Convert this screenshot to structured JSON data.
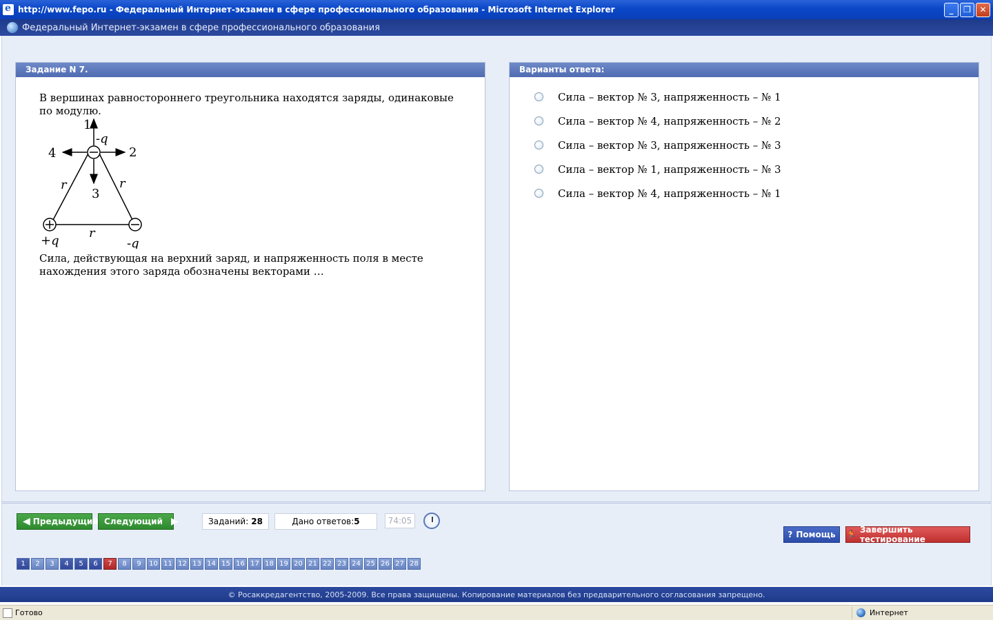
{
  "window": {
    "title": "http://www.fepo.ru - Федеральный Интернет-экзамен в сфере профессионального образования - Microsoft Internet Explorer",
    "minimize": "_",
    "restore": "❐",
    "close": "✕"
  },
  "app": {
    "header": "Федеральный Интернет-экзамен в сфере профессионального образования"
  },
  "task": {
    "title": "Задание N 7.",
    "text_before": "В вершинах равностороннего треугольника находятся заряды, одинаковые по модулю.",
    "text_after": "Сила, действующая на верхний заряд, и напряженность поля в месте нахождения этого заряда обозначены векторами …",
    "diagram": {
      "label_1": "1",
      "label_2": "2",
      "label_3": "3",
      "label_4": "4",
      "top_charge": "-q",
      "left_charge": "+q",
      "right_charge": "-q",
      "side_left": "r",
      "side_right": "r",
      "side_bottom": "r"
    }
  },
  "answers": {
    "title": "Варианты ответа:",
    "options": [
      "Сила – вектор № 3, напряженность – № 1",
      "Сила – вектор № 4, напряженность – № 2",
      "Сила – вектор № 3, напряженность – № 3",
      "Сила – вектор № 1, напряженность – № 3",
      "Сила – вектор № 4, напряженность – № 1"
    ]
  },
  "nav": {
    "prev": "Предыдущий",
    "next": "Следующий",
    "tasks_label": "Заданий:",
    "tasks_count": "28",
    "answers_label": "Дано ответов:",
    "answers_count": "5",
    "timer": "74:05",
    "help": "Помощь",
    "finish": "Завершить тестирование"
  },
  "pages": [
    "1",
    "2",
    "3",
    "4",
    "5",
    "6",
    "7",
    "8",
    "9",
    "10",
    "11",
    "12",
    "13",
    "14",
    "15",
    "16",
    "17",
    "18",
    "19",
    "20",
    "21",
    "22",
    "23",
    "24",
    "25",
    "26",
    "27",
    "28"
  ],
  "footer": "© Росаккредагентство, 2005-2009. Все права защищены. Копирование материалов без предварительного согласования запрещено.",
  "statusbar": {
    "status": "Готово",
    "zone": "Интернет"
  },
  "colors": {
    "header_blue": "#1e3a8a",
    "panel_head": "#5b77bc",
    "nav_green": "#3a983a",
    "finish_red": "#c83838",
    "current_page": "#c03a3a"
  }
}
